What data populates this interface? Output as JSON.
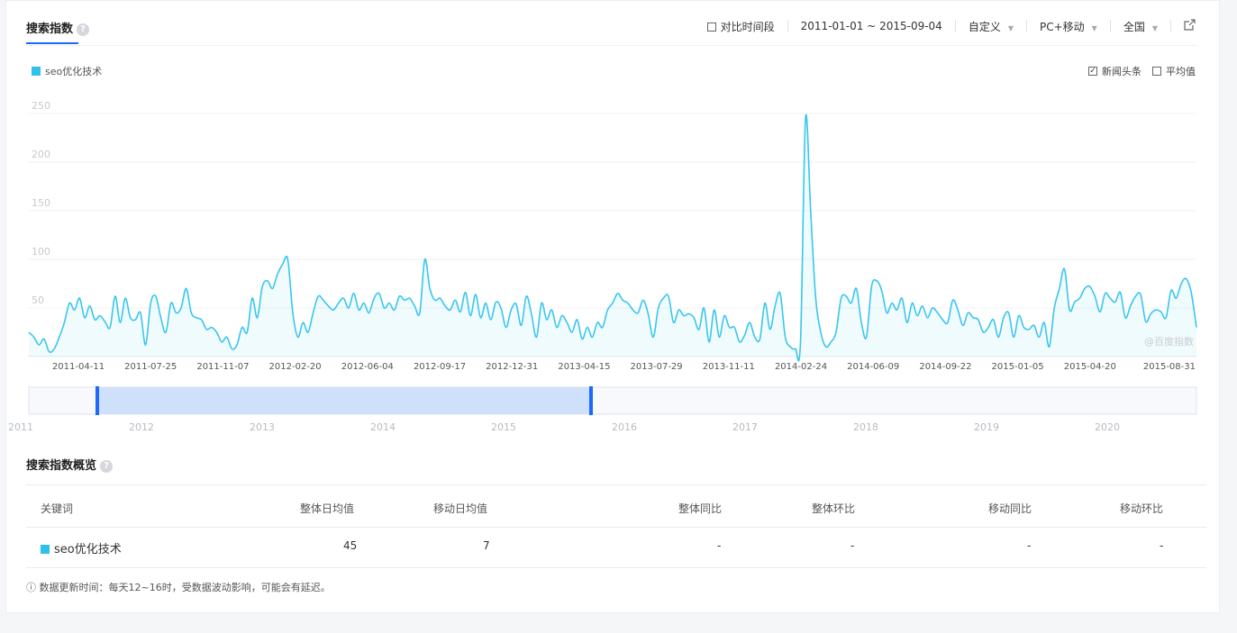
{
  "header": {
    "title": "搜索指数",
    "help": "?"
  },
  "toolbar": {
    "compare_label": "对比时间段",
    "date_range": "2011-01-01 ~ 2015-09-04",
    "custom_label": "自定义",
    "device_label": "PC+移动",
    "region_label": "全国",
    "export_icon": "external-link-icon"
  },
  "legend": {
    "series_name": "seo优化技术",
    "color": "#2fc1ea"
  },
  "options": {
    "news_label": "新闻头条",
    "news_checked": true,
    "avg_label": "平均值",
    "avg_checked": false
  },
  "watermark": "@百度指数",
  "chart_data": {
    "type": "area",
    "title": "",
    "ylim": [
      0,
      250
    ],
    "yticks": [
      "250",
      "200",
      "150",
      "100",
      "50"
    ],
    "x_tick_labels": [
      "2011-04-11",
      "2011-07-25",
      "2011-11-07",
      "2012-02-20",
      "2012-06-04",
      "2012-09-17",
      "2012-12-31",
      "2013-04-15",
      "2013-07-29",
      "2013-11-11",
      "2014-02-24",
      "2014-06-09",
      "2014-09-22",
      "2015-01-05",
      "2015-04-20",
      "2015-08-31"
    ],
    "grid": true,
    "series": [
      {
        "name": "seo优化技术",
        "color": "#2fc1ea",
        "values": [
          25,
          20,
          12,
          18,
          5,
          8,
          20,
          35,
          55,
          48,
          60,
          40,
          52,
          38,
          42,
          36,
          30,
          62,
          35,
          60,
          40,
          38,
          45,
          12,
          55,
          62,
          40,
          25,
          55,
          45,
          50,
          70,
          45,
          40,
          38,
          28,
          30,
          25,
          15,
          20,
          8,
          12,
          30,
          25,
          60,
          40,
          72,
          78,
          70,
          85,
          95,
          100,
          45,
          20,
          35,
          25,
          45,
          62,
          58,
          52,
          48,
          55,
          60,
          50,
          65,
          48,
          55,
          45,
          60,
          65,
          50,
          55,
          48,
          62,
          58,
          60,
          52,
          45,
          100,
          70,
          58,
          60,
          52,
          48,
          58,
          46,
          66,
          42,
          64,
          40,
          55,
          38,
          56,
          50,
          30,
          48,
          54,
          32,
          62,
          44,
          20,
          55,
          38,
          48,
          30,
          42,
          35,
          25,
          38,
          18,
          30,
          20,
          35,
          30,
          48,
          55,
          65,
          58,
          55,
          48,
          45,
          58,
          44,
          20,
          50,
          60,
          62,
          35,
          48,
          42,
          44,
          40,
          28,
          50,
          15,
          48,
          20,
          42,
          30,
          30,
          15,
          22,
          35,
          20,
          18,
          55,
          28,
          52,
          65,
          20,
          10,
          8,
          15,
          245,
          150,
          60,
          25,
          10,
          15,
          25,
          60,
          62,
          55,
          70,
          35,
          20,
          72,
          78,
          68,
          45,
          55,
          48,
          60,
          35,
          55,
          42,
          52,
          40,
          50,
          45,
          38,
          35,
          58,
          48,
          32,
          45,
          40,
          38,
          25,
          30,
          38,
          20,
          40,
          45,
          20,
          42,
          30,
          28,
          32,
          20,
          35,
          10,
          50,
          70,
          90,
          48,
          56,
          60,
          70,
          72,
          62,
          46,
          65,
          60,
          56,
          66,
          40,
          52,
          62,
          64,
          36,
          44,
          48,
          46,
          40,
          68,
          60,
          75,
          80,
          65,
          30
        ]
      }
    ]
  },
  "navigator": {
    "year_labels": [
      "2011",
      "2012",
      "2013",
      "2014",
      "2015",
      "2016",
      "2017",
      "2018",
      "2019",
      "2020"
    ]
  },
  "overview": {
    "title": "搜索指数概览",
    "columns": {
      "keyword": "关键词",
      "overall_daily": "整体日均值",
      "mobile_daily": "移动日均值",
      "overall_yoy": "整体同比",
      "overall_mom": "整体环比",
      "mobile_yoy": "移动同比",
      "mobile_mom": "移动环比"
    },
    "row": {
      "keyword": "seo优化技术",
      "overall_daily": "45",
      "mobile_daily": "7",
      "overall_yoy": "-",
      "overall_mom": "-",
      "mobile_yoy": "-",
      "mobile_mom": "-"
    }
  },
  "footnote": "ⓘ 数据更新时间：每天12~16时，受数据波动影响，可能会有延迟。"
}
